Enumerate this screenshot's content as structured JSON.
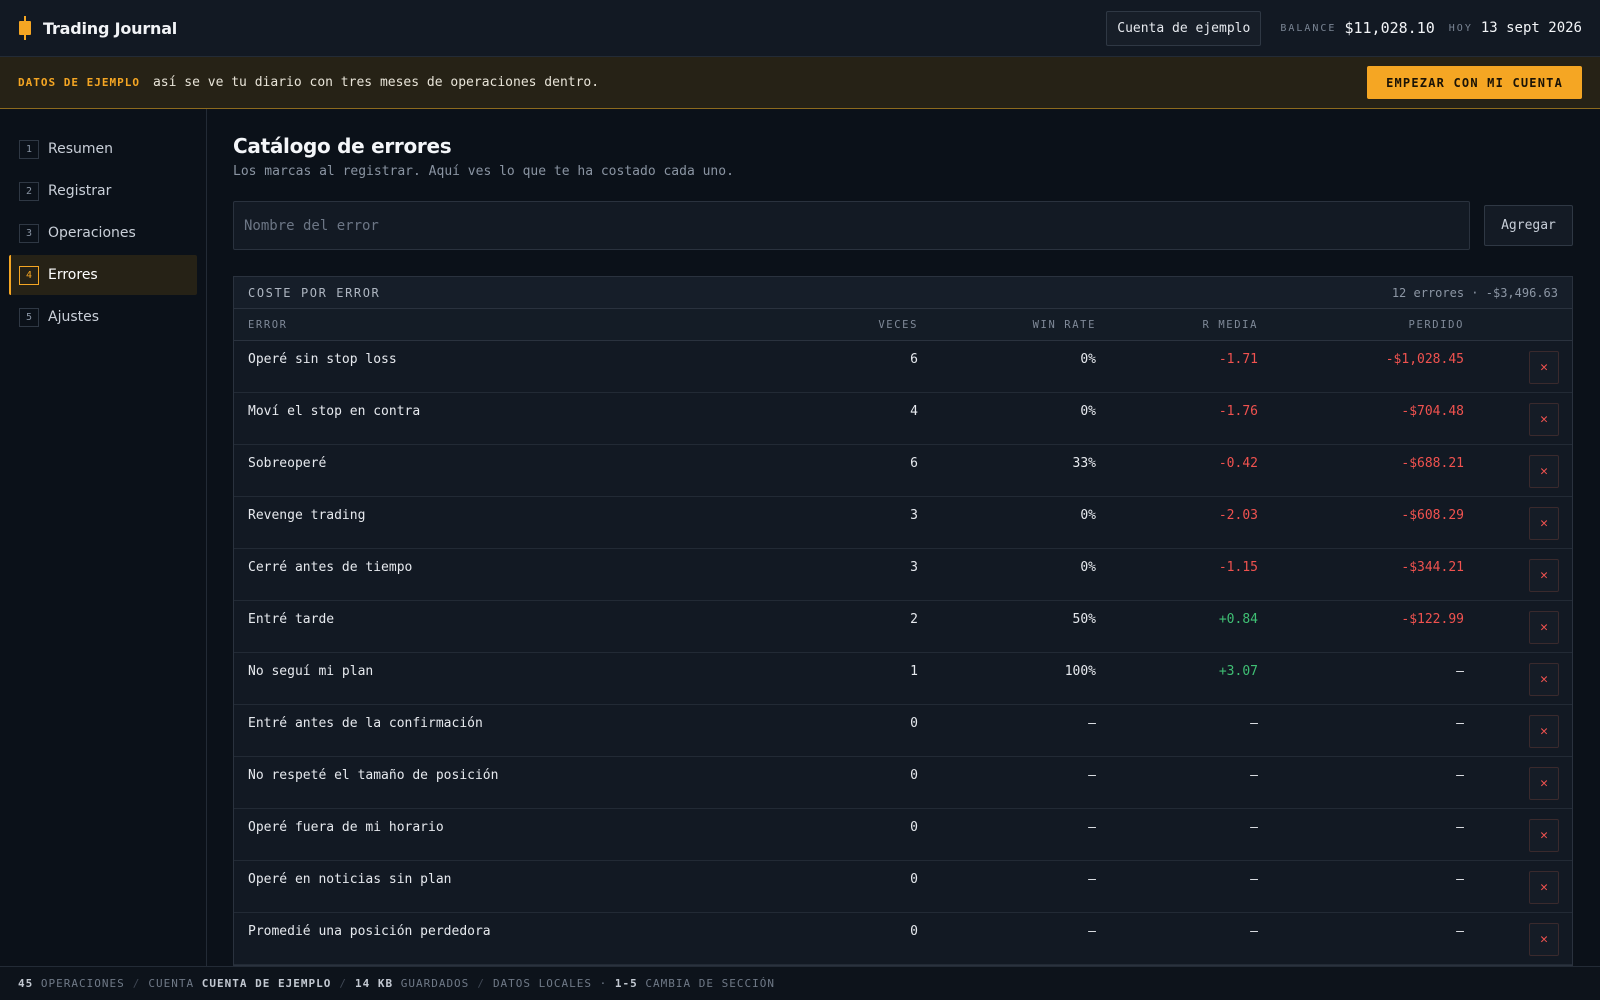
{
  "header": {
    "app_title": "Trading Journal",
    "account": "Cuenta de ejemplo",
    "balance_label": "BALANCE",
    "balance_value": "$11,028.10",
    "today_label": "HOY",
    "today_value": "13 sept 2026"
  },
  "banner": {
    "tag": "DATOS DE EJEMPLO",
    "text": "así se ve tu diario con tres meses de operaciones dentro.",
    "button": "EMPEZAR CON MI CUENTA"
  },
  "sidebar": {
    "items": [
      {
        "num": "1",
        "label": "Resumen"
      },
      {
        "num": "2",
        "label": "Registrar"
      },
      {
        "num": "3",
        "label": "Operaciones"
      },
      {
        "num": "4",
        "label": "Errores",
        "active": true
      },
      {
        "num": "5",
        "label": "Ajustes"
      }
    ]
  },
  "main": {
    "title": "Catálogo de errores",
    "subtitle": "Los marcas al registrar. Aquí ves lo que te ha costado cada uno.",
    "input_placeholder": "Nombre del error",
    "add_button": "Agregar",
    "table": {
      "title": "COSTE POR ERROR",
      "summary": "12 errores · -$3,496.63",
      "columns": {
        "error": "ERROR",
        "times": "VECES",
        "win_rate": "WIN RATE",
        "r_avg": "R MEDIA",
        "lost": "PERDIDO"
      },
      "rows": [
        {
          "name": "Operé sin stop loss",
          "times": "6",
          "win": "0%",
          "r": "-1.71",
          "lost": "-$1,028.45"
        },
        {
          "name": "Moví el stop en contra",
          "times": "4",
          "win": "0%",
          "r": "-1.76",
          "lost": "-$704.48"
        },
        {
          "name": "Sobreoperé",
          "times": "6",
          "win": "33%",
          "r": "-0.42",
          "lost": "-$688.21"
        },
        {
          "name": "Revenge trading",
          "times": "3",
          "win": "0%",
          "r": "-2.03",
          "lost": "-$608.29"
        },
        {
          "name": "Cerré antes de tiempo",
          "times": "3",
          "win": "0%",
          "r": "-1.15",
          "lost": "-$344.21"
        },
        {
          "name": "Entré tarde",
          "times": "2",
          "win": "50%",
          "r": "+0.84",
          "lost": "-$122.99"
        },
        {
          "name": "No seguí mi plan",
          "times": "1",
          "win": "100%",
          "r": "+3.07",
          "lost": "—"
        },
        {
          "name": "Entré antes de la confirmación",
          "times": "0",
          "win": "—",
          "r": "—",
          "lost": "—"
        },
        {
          "name": "No respeté el tamaño de posición",
          "times": "0",
          "win": "—",
          "r": "—",
          "lost": "—"
        },
        {
          "name": "Operé fuera de mi horario",
          "times": "0",
          "win": "—",
          "r": "—",
          "lost": "—"
        },
        {
          "name": "Operé en noticias sin plan",
          "times": "0",
          "win": "—",
          "r": "—",
          "lost": "—"
        },
        {
          "name": "Promedié una posición perdedora",
          "times": "0",
          "win": "—",
          "r": "—",
          "lost": "—"
        }
      ]
    }
  },
  "footer": {
    "ops_count": "45",
    "ops_label": "OPERACIONES",
    "account_label": "CUENTA",
    "account_value": "CUENTA DE EJEMPLO",
    "size_value": "14 KB",
    "size_label": "GUARDADOS",
    "local_label": "DATOS LOCALES ·",
    "shortcut_keys": "1-5",
    "shortcut_label": "CAMBIA DE SECCIÓN"
  },
  "colors": {
    "accent": "#f5a623",
    "negative": "#f0524f",
    "positive": "#3fbf74",
    "background": "#0b1119"
  },
  "icons": {
    "logo": "candlestick-icon",
    "delete": "close-icon"
  }
}
